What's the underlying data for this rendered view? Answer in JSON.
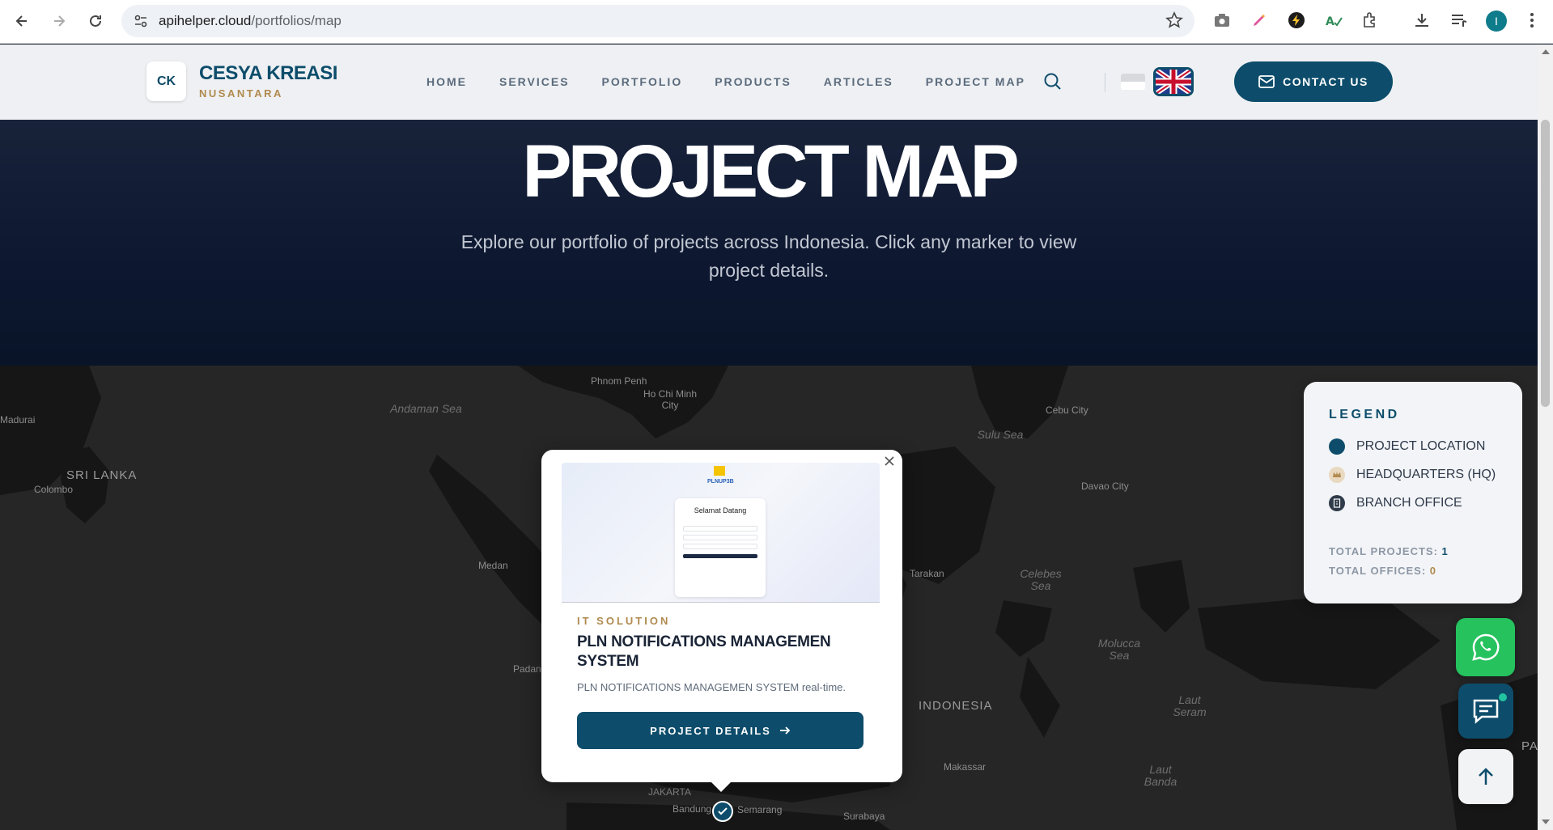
{
  "browser": {
    "url_host": "apihelper.cloud",
    "url_path": "/portfolios/map",
    "profile_initial": "I"
  },
  "header": {
    "brand_name": "CESYA KREASI",
    "brand_sub": "NUSANTARA",
    "logo_text": "CK",
    "nav": [
      "HOME",
      "SERVICES",
      "PORTFOLIO",
      "PRODUCTS",
      "ARTICLES",
      "PROJECT MAP"
    ],
    "contact_label": "CONTACT US"
  },
  "hero": {
    "title": "PROJECT MAP",
    "subtitle": "Explore our portfolio of projects across Indonesia. Click any marker to view project details."
  },
  "map": {
    "seas": [
      "Andaman Sea",
      "Sulu Sea",
      "Celebes Sea",
      "Molucca Sea",
      "Laut Seram",
      "Laut Banda"
    ],
    "cities": [
      "Phnom Penh",
      "Ho Chi Minh City",
      "Cebu City",
      "Madurai",
      "Colombo",
      "Davao City",
      "Medan",
      "Tarakan",
      "Padang",
      "Makassar",
      "JAKARTA",
      "Bandung",
      "Semarang",
      "Surabaya"
    ],
    "countries": [
      "SRI LANKA",
      "INDONESIA",
      "PA"
    ]
  },
  "popup": {
    "category": "IT SOLUTION",
    "title": "PLN NOTIFICATIONS MANAGEMEN SYSTEM",
    "description": "PLN NOTIFICATIONS MANAGEMEN SYSTEM real-time.",
    "button_label": "PROJECT DETAILS",
    "image_brand": "PLNUP3B",
    "image_card_title": "Selamat Datang"
  },
  "legend": {
    "title": "LEGEND",
    "items": [
      {
        "label": "PROJECT LOCATION",
        "icon": "dot",
        "color": "#0d4d6b"
      },
      {
        "label": "HEADQUARTERS (HQ)",
        "icon": "crown-icon",
        "color": "#b08a4e"
      },
      {
        "label": "BRANCH OFFICE",
        "icon": "building-icon",
        "color": "#2f3a4a"
      }
    ],
    "total_projects_label": "TOTAL PROJECTS:",
    "total_projects_value": "1",
    "total_offices_label": "TOTAL OFFICES:",
    "total_offices_value": "0"
  },
  "colors": {
    "brand_primary": "#0d4d6b",
    "brand_accent": "#b08a4e",
    "whatsapp": "#25c25e"
  }
}
